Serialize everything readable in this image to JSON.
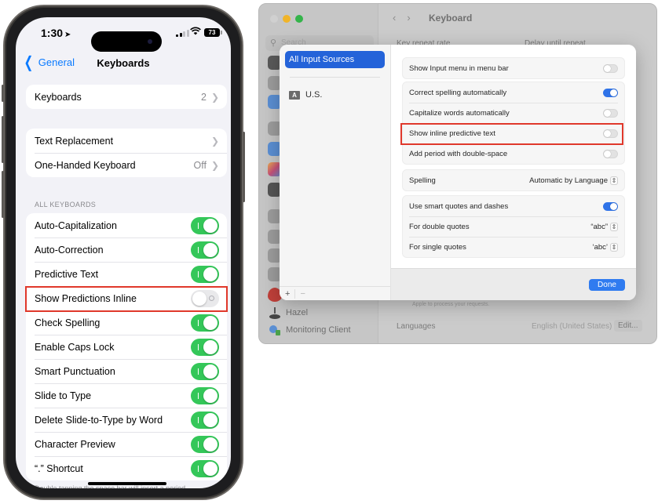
{
  "iphone": {
    "status_bar": {
      "time": "1:30",
      "battery": "73"
    },
    "nav": {
      "back_label": "General",
      "title": "Keyboards"
    },
    "group1": [
      {
        "label": "Keyboards",
        "value": "2"
      }
    ],
    "group2": [
      {
        "label": "Text Replacement",
        "value": ""
      },
      {
        "label": "One-Handed Keyboard",
        "value": "Off"
      }
    ],
    "section_header": "ALL KEYBOARDS",
    "toggles": [
      {
        "label": "Auto-Capitalization",
        "on": true
      },
      {
        "label": "Auto-Correction",
        "on": true
      },
      {
        "label": "Predictive Text",
        "on": true
      },
      {
        "label": "Show Predictions Inline",
        "on": false,
        "highlighted": true
      },
      {
        "label": "Check Spelling",
        "on": true
      },
      {
        "label": "Enable Caps Lock",
        "on": true
      },
      {
        "label": "Smart Punctuation",
        "on": true
      },
      {
        "label": "Slide to Type",
        "on": true
      },
      {
        "label": "Delete Slide-to-Type by Word",
        "on": true
      },
      {
        "label": "Character Preview",
        "on": true
      },
      {
        "label": "“.” Shortcut",
        "on": true
      }
    ],
    "footnote": "Double tapping the space bar will insert a period"
  },
  "mac": {
    "window_title": "Keyboard",
    "search_placeholder": "Search",
    "background": {
      "key_repeat_label": "Key repeat rate",
      "delay_label": "Delay until repeat",
      "apple_note": "Apple to process your requests.",
      "languages_label": "Languages",
      "languages_value": "English (United States)",
      "edit_button": "Edit..."
    },
    "sidebar_items": [
      {
        "label": "Hazel"
      },
      {
        "label": "Monitoring Client"
      }
    ],
    "sheet": {
      "sources": {
        "selected": "All Input Sources",
        "items": [
          {
            "badge": "A",
            "label": "U.S."
          }
        ],
        "add": "+",
        "remove": "−"
      },
      "group1": [
        {
          "label": "Show Input menu in menu bar",
          "on": false
        }
      ],
      "group2": [
        {
          "label": "Correct spelling automatically",
          "on": true
        },
        {
          "label": "Capitalize words automatically",
          "on": false
        },
        {
          "label": "Show inline predictive text",
          "on": false,
          "highlighted": true
        },
        {
          "label": "Add period with double-space",
          "on": false
        }
      ],
      "spelling": {
        "label": "Spelling",
        "value": "Automatic by Language"
      },
      "quotes": {
        "smart_label": "Use smart quotes and dashes",
        "smart_on": true,
        "double_label": "For double quotes",
        "double_value": "“abc”",
        "single_label": "For single quotes",
        "single_value": "‘abc’"
      },
      "done_label": "Done"
    }
  },
  "colors": {
    "ios_green": "#34c759",
    "ios_blue": "#0a7aff",
    "mac_blue": "#2f73e8",
    "highlight_red": "#e0382b"
  }
}
